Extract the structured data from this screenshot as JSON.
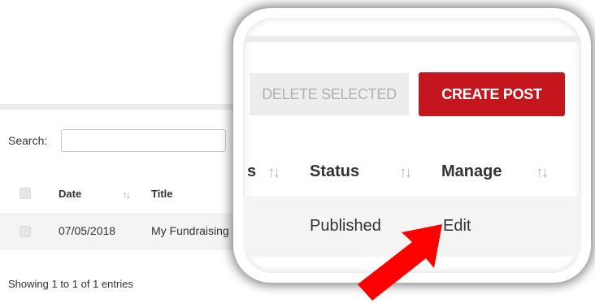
{
  "search": {
    "label": "Search:",
    "value": ""
  },
  "table": {
    "headers": {
      "date": "Date",
      "title": "Title"
    },
    "sort_glyph": "↑↓",
    "rows": [
      {
        "date": "07/05/2018",
        "title": "My Fundraising"
      }
    ]
  },
  "info": "Showing 1 to 1 of 1 entries",
  "zoom": {
    "delete_label": "DELETE SELECTED",
    "create_label": "CREATE POST",
    "header_partial": "s",
    "header_status": "Status",
    "header_manage": "Manage",
    "row_status": "Published",
    "row_manage": "Edit"
  },
  "colors": {
    "accent": "#c4161c",
    "arrow": "#ff0000"
  },
  "annotation": {
    "icon": "red-arrow-icon"
  }
}
